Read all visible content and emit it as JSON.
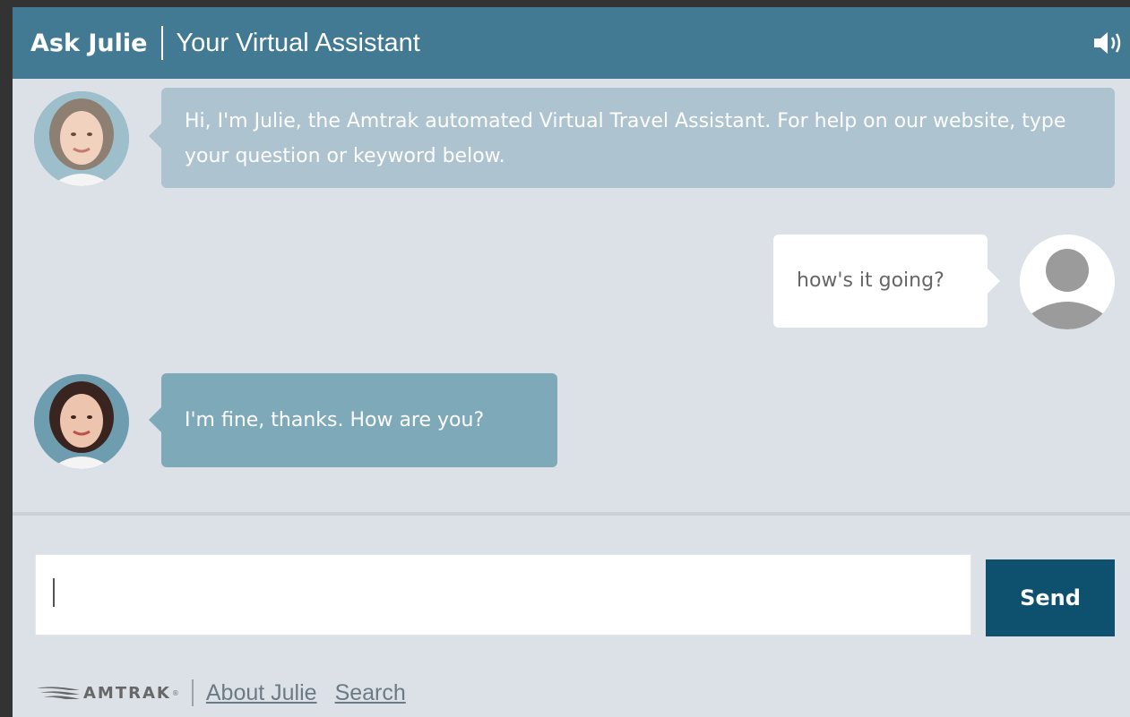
{
  "header": {
    "brand": "Ask Julie",
    "subtitle": "Your Virtual Assistant",
    "speaker_icon": "speaker-icon"
  },
  "messages": [
    {
      "sender": "bot",
      "text": "Hi, I'm Julie, the Amtrak automated Virtual Travel Assistant. For help on our website, type your question or keyword below."
    },
    {
      "sender": "user",
      "text": "how's it going?"
    },
    {
      "sender": "bot",
      "text": "I'm fine, thanks. How are you?"
    }
  ],
  "composer": {
    "input_value": "",
    "send_label": "Send"
  },
  "footer": {
    "logo_text": "AMTRAK",
    "logo_mark": "®",
    "links": [
      "About Julie",
      "Search"
    ]
  },
  "colors": {
    "header_bg": "#417a92",
    "send_bg": "#0d516e",
    "chat_bg": "#dbe1e6",
    "bot_bubble_old": "#adc3cf",
    "bot_bubble": "#7ea9b9"
  }
}
